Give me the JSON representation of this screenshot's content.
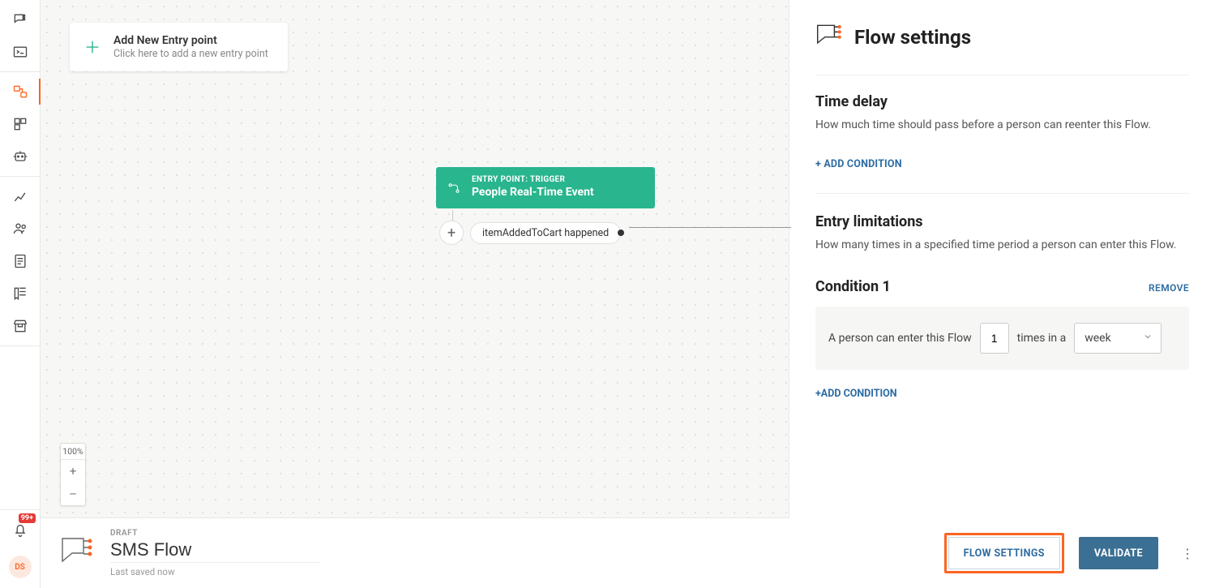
{
  "nav": {
    "notification_count": "99+",
    "avatar_initials": "DS"
  },
  "canvas": {
    "add_entry": {
      "title": "Add New Entry point",
      "subtitle": "Click here to add a new entry point"
    },
    "node": {
      "eyebrow": "ENTRY POINT: TRIGGER",
      "title": "People Real-Time Event",
      "condition": "itemAddedToCart happened"
    },
    "zoom": {
      "level": "100%",
      "plus": "+",
      "minus": "–"
    }
  },
  "panel": {
    "title": "Flow settings",
    "time_delay": {
      "title": "Time delay",
      "desc": "How much time should pass before a person can reenter this Flow.",
      "add_condition": "+ ADD CONDITION"
    },
    "entry_limitations": {
      "title": "Entry limitations",
      "desc": "How many times in a specified time period a person can enter this Flow.",
      "condition_label": "Condition 1",
      "remove": "REMOVE",
      "sentence_pre": "A person can enter this Flow",
      "times_value": "1",
      "sentence_mid": "times in a",
      "period_value": "week",
      "add_condition": "+ADD CONDITION"
    }
  },
  "footer": {
    "status": "DRAFT",
    "flow_name": "SMS Flow",
    "last_saved": "Last saved now",
    "flow_settings_btn": "FLOW SETTINGS",
    "validate_btn": "VALIDATE",
    "kebab": "⋮"
  }
}
